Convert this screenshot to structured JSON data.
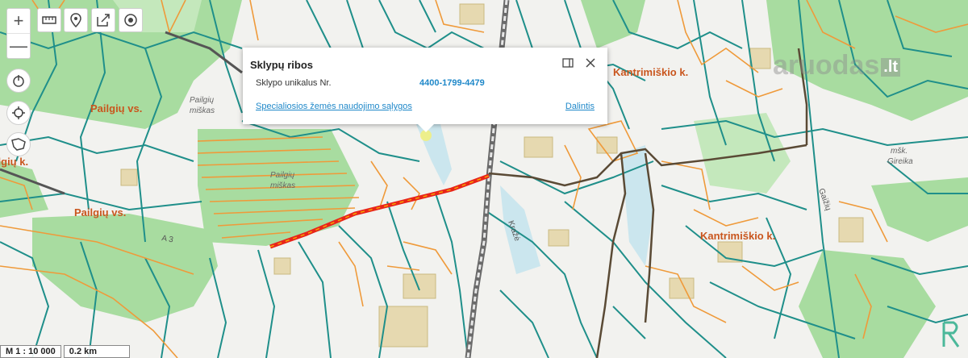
{
  "map": {
    "place_labels": [
      {
        "id": "pailgiu-vs-top",
        "text": "Pailgių vs."
      },
      {
        "id": "pailgiu-vs-bottom",
        "text": "Pailgių vs."
      },
      {
        "id": "kantrimiskio-top",
        "text": "Kantrimiškio k."
      },
      {
        "id": "kantrimiskio-bottom",
        "text": "Kantrimiškio k."
      },
      {
        "id": "pailgiu-k-left",
        "text": "Pailgių k."
      }
    ],
    "forest_labels": {
      "pailgiu_miskas_1_a": "Pailgių",
      "pailgiu_miskas_1_b": "miškas",
      "pailgiu_miskas_2_a": "Pailgių",
      "pailgiu_miskas_2_b": "miškas",
      "gireika_a": "mšk.",
      "gireika_b": "Gireika"
    },
    "road_labels": {
      "a3": "A 3",
      "krasta": "Kražė",
      "gaiziu": "Gaižių"
    },
    "colors": {
      "background": "#f2f2ef",
      "forest": "#a8dca0",
      "forest_light": "#c4e8bc",
      "parcel_teal": "#1f8f8a",
      "parcel_orange": "#ef9a3a",
      "selected_road": "#e8241a",
      "village_label": "#c9561e"
    }
  },
  "toolbar": {
    "zoom_in": "+",
    "zoom_out": "—",
    "icons": [
      "measure-line-icon",
      "map-pin-icon",
      "share-export-icon",
      "target-icon"
    ]
  },
  "side_controls": [
    "power-icon",
    "crosshair-icon",
    "shape-select-icon"
  ],
  "popup": {
    "title": "Sklypų ribos",
    "field_label": "Sklypo unikalus Nr.",
    "field_value": "4400-1799-4479",
    "link": "Specialiosios žemės naudojimo sąlygos",
    "share": "Dalintis"
  },
  "scale": {
    "ratio": "M 1 : 10 000",
    "distance": "0.2 km"
  },
  "watermark": {
    "text": "aruodas",
    "suffix": ".lt"
  }
}
